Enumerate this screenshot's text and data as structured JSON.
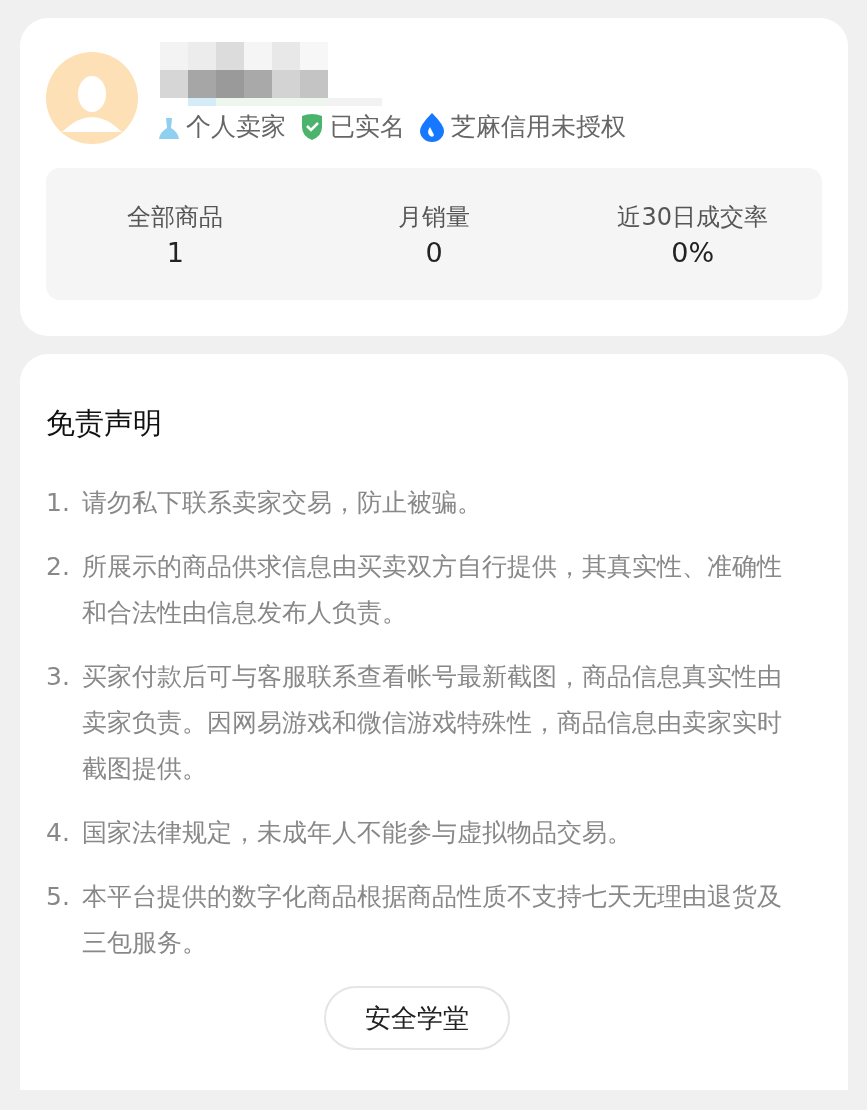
{
  "seller": {
    "badges": [
      {
        "kind": "person",
        "label": "个人卖家"
      },
      {
        "kind": "verified",
        "label": "已实名"
      },
      {
        "kind": "credit",
        "label": "芝麻信用未授权"
      }
    ]
  },
  "stats": [
    {
      "label": "全部商品",
      "value": "1"
    },
    {
      "label": "月销量",
      "value": "0"
    },
    {
      "label": "近30日成交率",
      "value": "0%"
    }
  ],
  "disclaimer": {
    "title": "免责声明",
    "items": [
      {
        "number": "1.",
        "text": "请勿私下联系卖家交易，防止被骗。"
      },
      {
        "number": "2.",
        "text": "所展示的商品供求信息由买卖双方自行提供，其真实性、准确性和合法性由信息发布人负责。"
      },
      {
        "number": "3.",
        "text": "买家付款后可与客服联系查看帐号最新截图，商品信息真实性由卖家负责。因网易游戏和微信游戏特殊性，商品信息由卖家实时截图提供。"
      },
      {
        "number": "4.",
        "text": "国家法律规定，未成年人不能参与虚拟物品交易。"
      },
      {
        "number": "5.",
        "text": "本平台提供的数字化商品根据商品性质不支持七天无理由退货及三包服务。"
      }
    ],
    "button": "安全学堂"
  }
}
